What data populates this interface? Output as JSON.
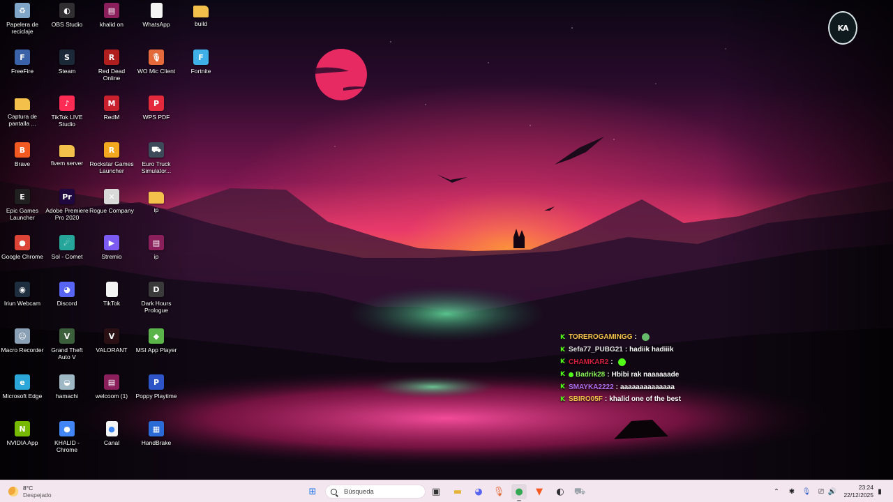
{
  "desktop": {
    "icons": [
      {
        "label": "Papelera de reciclaje",
        "icon": "recycle-bin-icon",
        "color": "#7fa6c9",
        "glyph": "♻"
      },
      {
        "label": "FreeFire",
        "icon": "freefire-icon",
        "color": "#3a62a8",
        "glyph": "F"
      },
      {
        "label": "Captura de pantalla ...",
        "icon": "folder-icon",
        "color": "#f2c04b",
        "glyph": ""
      },
      {
        "label": "Brave",
        "icon": "brave-icon",
        "color": "#f25a22",
        "glyph": "B"
      },
      {
        "label": "Epic Games Launcher",
        "icon": "epic-games-icon",
        "color": "#202020",
        "glyph": "E"
      },
      {
        "label": "Google Chrome",
        "icon": "chrome-icon",
        "color": "#db4437",
        "glyph": "●"
      },
      {
        "label": "Iriun Webcam",
        "icon": "webcam-icon",
        "color": "#1e2e3e",
        "glyph": "◉"
      },
      {
        "label": "Macro Recorder",
        "icon": "macro-recorder-icon",
        "color": "#8aa0b4",
        "glyph": "☺"
      },
      {
        "label": "Microsoft Edge",
        "icon": "edge-icon",
        "color": "#2aa6d8",
        "glyph": "e"
      },
      {
        "label": "NVIDIA App",
        "icon": "nvidia-icon",
        "color": "#76b900",
        "glyph": "N"
      },
      {
        "label": "OBS Studio",
        "icon": "obs-icon",
        "color": "#302e31",
        "glyph": "◐"
      },
      {
        "label": "Steam",
        "icon": "steam-icon",
        "color": "#1b2838",
        "glyph": "S"
      },
      {
        "label": "TikTok LIVE Studio",
        "icon": "tiktok-live-icon",
        "color": "#fe2c55",
        "glyph": "♪"
      },
      {
        "label": "fivem server",
        "icon": "folder-icon",
        "color": "#f2c04b",
        "glyph": ""
      },
      {
        "label": "Adobe Premiere Pro 2020",
        "icon": "premiere-icon",
        "color": "#1f0740",
        "glyph": "Pr"
      },
      {
        "label": "Sol - Comet",
        "icon": "sol-comet-icon",
        "color": "#26a69a",
        "glyph": "☄"
      },
      {
        "label": "Discord",
        "icon": "discord-icon",
        "color": "#5865f2",
        "glyph": "◕"
      },
      {
        "label": "Grand Theft Auto V",
        "icon": "gta-icon",
        "color": "#3a5f3a",
        "glyph": "V"
      },
      {
        "label": "hamachi",
        "icon": "hamachi-icon",
        "color": "#9fb8c6",
        "glyph": "◒"
      },
      {
        "label": "KHALID - Chrome",
        "icon": "chrome-icon",
        "color": "#4285f4",
        "glyph": "●"
      },
      {
        "label": "khalid on",
        "icon": "winrar-icon",
        "color": "#8a1f5c",
        "glyph": "▤"
      },
      {
        "label": "Red Dead Online",
        "icon": "rdo-icon",
        "color": "#b01e1e",
        "glyph": "R"
      },
      {
        "label": "RedM",
        "icon": "redm-icon",
        "color": "#c8202c",
        "glyph": "M"
      },
      {
        "label": "Rockstar Games Launcher",
        "icon": "rockstar-icon",
        "color": "#f3a81f",
        "glyph": "R"
      },
      {
        "label": "Rogue Company",
        "icon": "rogue-company-icon",
        "color": "#d9d9d9",
        "glyph": "✕"
      },
      {
        "label": "Stremio",
        "icon": "stremio-icon",
        "color": "#7b5bf2",
        "glyph": "▶"
      },
      {
        "label": "TikTok",
        "icon": "file-icon",
        "color": "#f4f4f4",
        "glyph": ""
      },
      {
        "label": "VALORANT",
        "icon": "valorant-icon",
        "color": "#2a1015",
        "glyph": "V"
      },
      {
        "label": "welcoom (1)",
        "icon": "winrar-icon",
        "color": "#8a1f5c",
        "glyph": "▤"
      },
      {
        "label": "Canal",
        "icon": "chrome-file-icon",
        "color": "#f4f4f4",
        "glyph": "●"
      },
      {
        "label": "WhatsApp",
        "icon": "file-icon",
        "color": "#f4f4f4",
        "glyph": ""
      },
      {
        "label": "WO Mic Client",
        "icon": "mic-icon",
        "color": "#e56a3b",
        "glyph": "🎙"
      },
      {
        "label": "WPS PDF",
        "icon": "wps-pdf-icon",
        "color": "#e5293c",
        "glyph": "P"
      },
      {
        "label": "Euro Truck Simulator...",
        "icon": "ets-icon",
        "color": "#3c4a5a",
        "glyph": "⛟"
      },
      {
        "label": "ip",
        "icon": "folder-icon",
        "color": "#f2c04b",
        "glyph": ""
      },
      {
        "label": "ip",
        "icon": "winrar-icon",
        "color": "#8a1f5c",
        "glyph": "▤"
      },
      {
        "label": "Dark Hours Prologue",
        "icon": "dark-hours-icon",
        "color": "#3a3a3a",
        "glyph": "D"
      },
      {
        "label": "MSI App Player",
        "icon": "msi-player-icon",
        "color": "#5ab44a",
        "glyph": "◆"
      },
      {
        "label": "Poppy Playtime",
        "icon": "poppy-icon",
        "color": "#2d55c8",
        "glyph": "P"
      },
      {
        "label": "HandBrake",
        "icon": "handbrake-icon",
        "color": "#2b6bd6",
        "glyph": "▦"
      },
      {
        "label": "build",
        "icon": "folder-icon",
        "color": "#f2c04b",
        "glyph": ""
      },
      {
        "label": "Fortnite",
        "icon": "fortnite-icon",
        "color": "#3fb0e8",
        "glyph": "F"
      }
    ]
  },
  "emblem": {
    "mark": "KA",
    "icon": "phoenix-emblem-icon"
  },
  "chat": {
    "messages": [
      {
        "user": "TOREROGAMINGG",
        "text": "",
        "user_color": "#f5c34a",
        "emote": "#66bb6a",
        "badge": false
      },
      {
        "user": "Sefa77_PUBG21",
        "text": "hadiik hadiiik",
        "user_color": "#e7e7e7",
        "emote": "",
        "badge": false
      },
      {
        "user": "CHAMKAR2",
        "text": "",
        "user_color": "#d21f3c",
        "emote": "#53fc18",
        "badge": false
      },
      {
        "user": "Badrik28",
        "text": "Hbibi rak naaaaaade",
        "user_color": "#8cf55a",
        "emote": "",
        "badge": true
      },
      {
        "user": "SMAYKA2222",
        "text": "aaaaaaaaaaaaaa",
        "user_color": "#b06ef0",
        "emote": "",
        "badge": false
      },
      {
        "user": "SBIRO05F",
        "text": "khalid one of the best",
        "user_color": "#f5c34a",
        "emote": "",
        "badge": false
      }
    ]
  },
  "taskbar": {
    "weather": {
      "temp": "8°C",
      "condition": "Despejado"
    },
    "search_placeholder": "Búsqueda",
    "apps": [
      {
        "name": "start-button",
        "glyph": "⊞",
        "color": "#1a73e8",
        "active": false
      },
      {
        "name": "task-view-button",
        "glyph": "▣",
        "color": "#333333",
        "active": false
      },
      {
        "name": "file-explorer-button",
        "glyph": "▬",
        "color": "#e8b33b",
        "active": false
      },
      {
        "name": "discord-taskbar-button",
        "glyph": "◕",
        "color": "#5865f2",
        "active": false
      },
      {
        "name": "wo-mic-taskbar-button",
        "glyph": "🎙",
        "color": "#e56a3b",
        "active": false
      },
      {
        "name": "chrome-taskbar-button",
        "glyph": "●",
        "color": "#34a853",
        "active": true
      },
      {
        "name": "brave-taskbar-button",
        "glyph": "▼",
        "color": "#f25a22",
        "active": false
      },
      {
        "name": "obs-taskbar-button",
        "glyph": "◐",
        "color": "#302e31",
        "active": false
      },
      {
        "name": "ets-taskbar-button",
        "glyph": "⛟",
        "color": "#9aa3aa",
        "active": false
      }
    ],
    "tray": {
      "chevron": "⌃",
      "settings": "✱",
      "mic": "🎙",
      "network": "⎚",
      "volume": "🔊",
      "notify": "▮"
    },
    "time": "23:24",
    "date": "22/12/2025"
  }
}
